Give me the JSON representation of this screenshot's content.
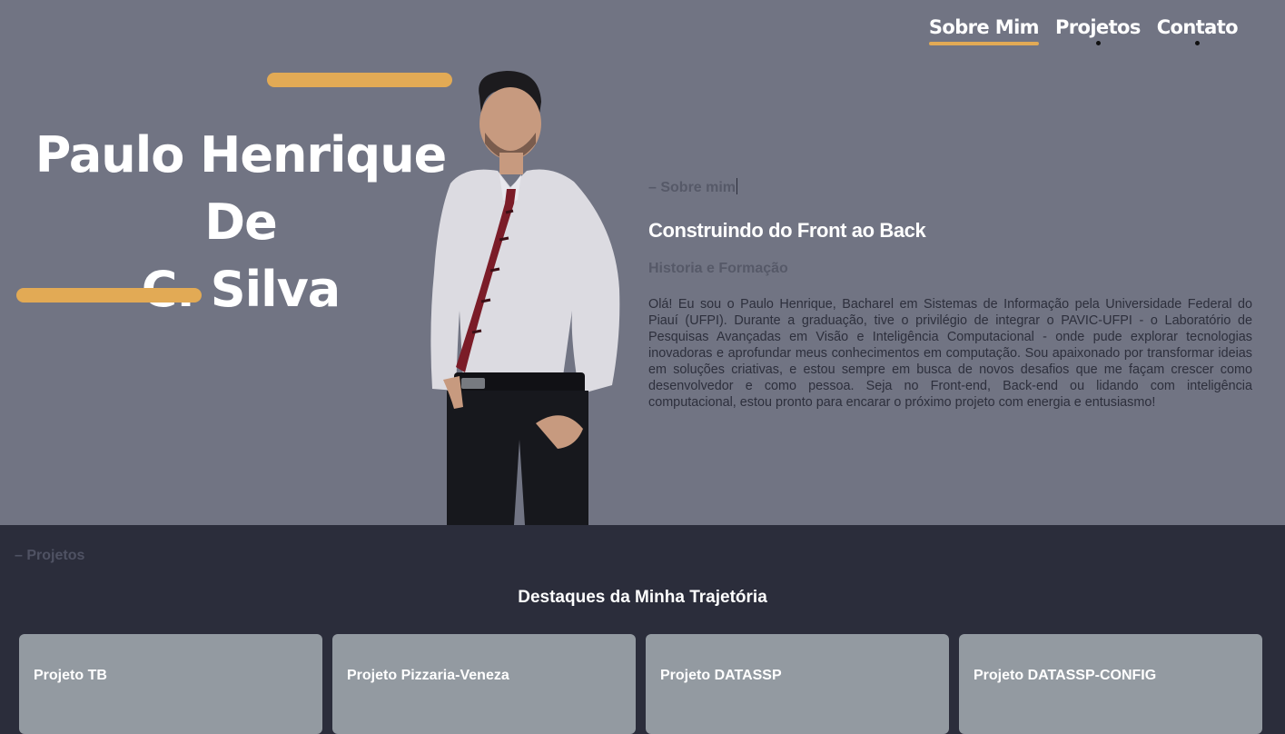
{
  "nav": {
    "items": [
      "Sobre Mim",
      "Projetos",
      "Contato"
    ]
  },
  "hero": {
    "name_line1": "Paulo Henrique De",
    "name_line2": "C. Silva"
  },
  "about": {
    "tag": "– Sobre mim",
    "title": "Construindo do Front ao Back",
    "subtitle": "Historia e Formação",
    "body": "Olá! Eu sou o Paulo Henrique, Bacharel em Sistemas de Informação pela Universidade Federal do Piauí (UFPI). Durante a graduação, tive o privilégio de integrar o PAVIC-UFPI - o Laboratório de Pesquisas Avançadas em Visão e Inteligência Computacional - onde pude explorar tecnologias inovadoras e aprofundar meus conhecimentos em computação. Sou apaixonado por transformar ideias em soluções criativas, e estou sempre em busca de novos desafios que me façam crescer como desenvolvedor e como pessoa. Seja no Front-end, Back-end ou lidando com inteligência computacional, estou pronto para encarar o próximo projeto com energia e entusiasmo!"
  },
  "projects": {
    "tag": "– Projetos",
    "title": "Destaques da Minha Trajetória",
    "cards": [
      {
        "title": "Projeto TB"
      },
      {
        "title": "Projeto Pizzaria-Veneza"
      },
      {
        "title": "Projeto DATASSP"
      },
      {
        "title": "Projeto DATASSP-CONFIG"
      }
    ]
  },
  "colors": {
    "accent": "#e2aa55",
    "hero_bg": "#717483",
    "projects_bg": "#2b2d3b",
    "card_bg": "#939aa1"
  }
}
